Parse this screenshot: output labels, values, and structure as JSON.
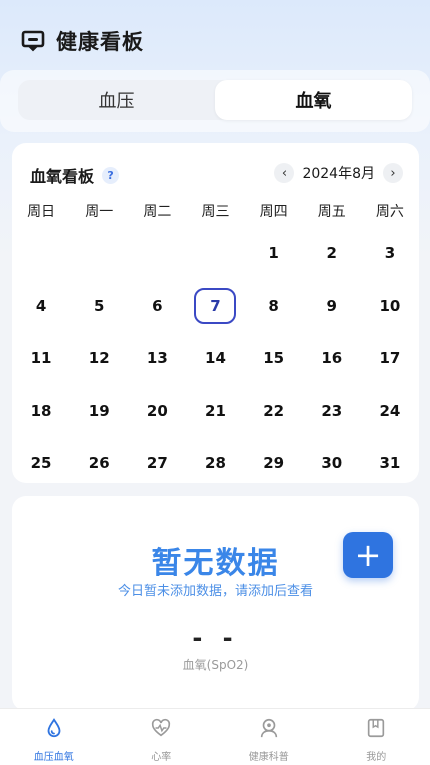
{
  "header": {
    "title": "健康看板",
    "logo_icon": "monitor-chat-icon"
  },
  "tabs": [
    {
      "label": "血压",
      "active": false
    },
    {
      "label": "血氧",
      "active": true
    }
  ],
  "calendar": {
    "title": "血氧看板",
    "help": "?",
    "month": "2024年8月",
    "prev": "‹",
    "next": "›",
    "weekdays": [
      "周日",
      "周一",
      "周二",
      "周三",
      "周四",
      "周五",
      "周六"
    ],
    "first_weekday_index": 4,
    "days_in_month": 31,
    "today": 7
  },
  "empty": {
    "title": "暂无数据",
    "subtitle": "今日暂未添加数据，请添加后查看",
    "add": "+",
    "value": "- -",
    "value_label": "血氧(SpO2)"
  },
  "bottom_nav": [
    {
      "label": "血压血氧",
      "icon": "drop-icon",
      "active": true
    },
    {
      "label": "心率",
      "icon": "heart-rate-icon",
      "active": false
    },
    {
      "label": "健康科普",
      "icon": "doctor-icon",
      "active": false
    },
    {
      "label": "我的",
      "icon": "book-icon",
      "active": false
    }
  ],
  "colors": {
    "accent": "#2f74e0",
    "today_ring": "#3b49c4",
    "empty_title": "#3a86e8"
  }
}
